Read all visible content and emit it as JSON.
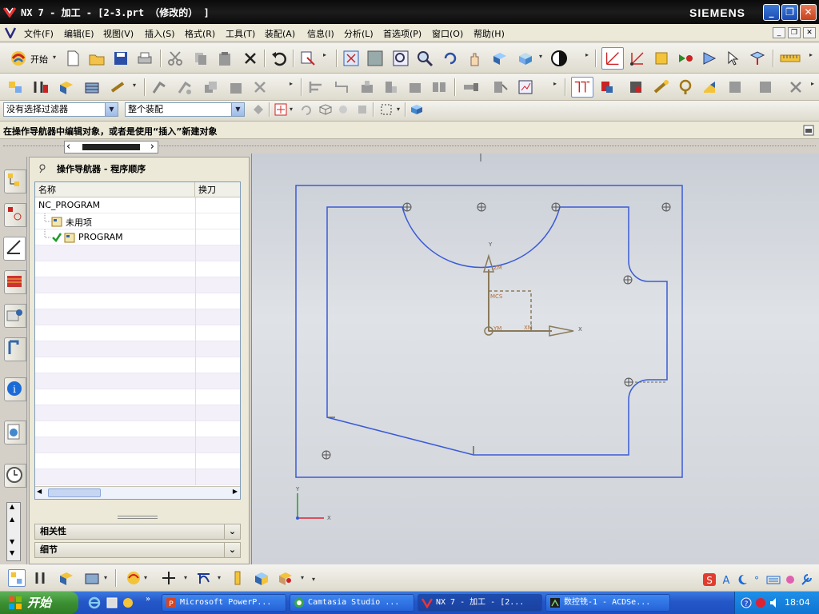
{
  "window": {
    "title": "NX 7 - 加工 - [2-3.prt （修改的） ]",
    "brand": "SIEMENS"
  },
  "menu": {
    "items": [
      "文件(F)",
      "编辑(E)",
      "视图(V)",
      "插入(S)",
      "格式(R)",
      "工具(T)",
      "装配(A)",
      "信息(I)",
      "分析(L)",
      "首选项(P)",
      "窗口(O)",
      "帮助(H)"
    ]
  },
  "toolbar": {
    "start_label": "开始"
  },
  "filter": {
    "selection_filter": "没有选择过滤器",
    "scope": "整个装配"
  },
  "status": {
    "message": "在操作导航器中编辑对象，或者是使用“插入”新建对象"
  },
  "navigator": {
    "title": "操作导航器 - 程序顺序",
    "columns": [
      "名称",
      "换刀"
    ],
    "rows": [
      {
        "name": "NC_PROGRAM"
      },
      {
        "name": "未用项"
      },
      {
        "name": "PROGRAM"
      }
    ],
    "sections": [
      "相关性",
      "细节"
    ]
  },
  "viewport": {
    "wcs_labels": {
      "x": "X",
      "y": "Y",
      "zm": "ZM",
      "xm": "XM",
      "ym": "YM",
      "mcs": "MCS"
    }
  },
  "taskbar": {
    "start": "开始",
    "buttons": [
      "Microsoft PowerP...",
      "Camtasia Studio ...",
      "NX 7 - 加工 - [2...",
      "数控铣-1 - ACDSe..."
    ],
    "clock": "18:04"
  },
  "colors": {
    "part_outline": "#3b5bd6",
    "accent": "#2457c9"
  }
}
